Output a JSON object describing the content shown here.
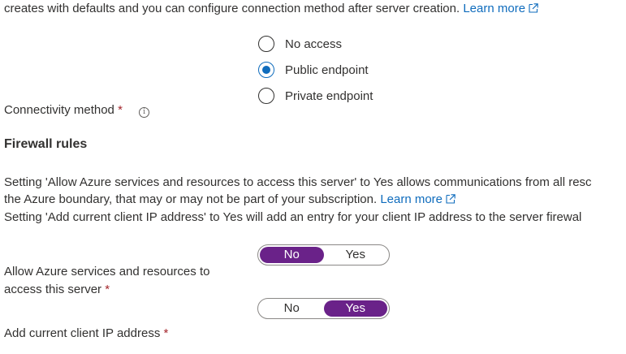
{
  "top_text": {
    "text": "creates with defaults and you can configure connection method after server creation.",
    "link": "Learn more"
  },
  "connectivity": {
    "label": "Connectivity method",
    "required_mark": "*",
    "info_glyph": "i",
    "options": [
      {
        "label": "No access",
        "selected": false
      },
      {
        "label": "Public endpoint",
        "selected": true
      },
      {
        "label": "Private endpoint",
        "selected": false
      }
    ]
  },
  "firewall": {
    "heading": "Firewall rules",
    "desc_line1": "Setting 'Allow Azure services and resources to access this server' to Yes allows communications from all resc",
    "desc_line2_text": "the Azure boundary, that may or may not be part of your subscription.",
    "desc_line2_link": "Learn more",
    "desc_line3": "Setting 'Add current client IP address' to Yes will add an entry for your client IP address to the server firewal"
  },
  "allow_azure": {
    "label_line1": "Allow Azure services and resources to",
    "label_line2": "access this server",
    "required_mark": "*",
    "no_label": "No",
    "yes_label": "Yes",
    "value": "No"
  },
  "client_ip": {
    "label": "Add current client IP address",
    "required_mark": "*",
    "no_label": "No",
    "yes_label": "Yes",
    "value": "Yes"
  },
  "colors": {
    "link": "#0f6cbd",
    "radio_selected": "#0f6cbd",
    "toggle_active": "#6a2289",
    "required": "#a4262c"
  }
}
